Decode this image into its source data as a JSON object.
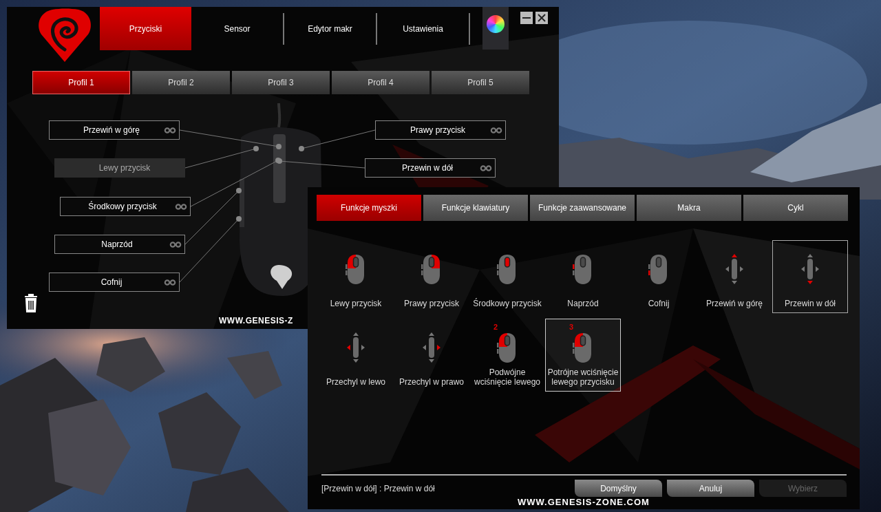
{
  "main_window": {
    "top_tabs": [
      {
        "label": "Przyciski",
        "selected": true
      },
      {
        "label": "Sensor",
        "selected": false
      },
      {
        "label": "Edytor makr",
        "selected": false
      },
      {
        "label": "Ustawienia",
        "selected": false
      }
    ],
    "profiles": [
      {
        "label": "Profil 1",
        "selected": true
      },
      {
        "label": "Profil 2",
        "selected": false
      },
      {
        "label": "Profil 3",
        "selected": false
      },
      {
        "label": "Profil 4",
        "selected": false
      },
      {
        "label": "Profil 5",
        "selected": false
      }
    ],
    "button_assignments": [
      {
        "label": "Przewiń w górę",
        "disabled": false
      },
      {
        "label": "Lewy przycisk",
        "disabled": true
      },
      {
        "label": "Środkowy przycisk",
        "disabled": false
      },
      {
        "label": "Naprzód",
        "disabled": false
      },
      {
        "label": "Cofnij",
        "disabled": false
      },
      {
        "label": "Prawy przycisk",
        "disabled": false
      },
      {
        "label": "Przewin w dół",
        "disabled": false
      }
    ],
    "website": "WWW.GENESIS-Z"
  },
  "dialog": {
    "tabs": [
      {
        "label": "Funkcje myszki",
        "selected": true
      },
      {
        "label": "Funkcje klawiatury",
        "selected": false
      },
      {
        "label": "Funkcje zaawansowane",
        "selected": false
      },
      {
        "label": "Makra",
        "selected": false
      },
      {
        "label": "Cykl",
        "selected": false
      }
    ],
    "functions": [
      {
        "label": "Lewy przycisk",
        "kind": "left",
        "selected": false,
        "hovered": false
      },
      {
        "label": "Prawy przycisk",
        "kind": "right",
        "selected": false,
        "hovered": false
      },
      {
        "label": "Środkowy przycisk",
        "kind": "middle",
        "selected": false,
        "hovered": false
      },
      {
        "label": "Naprzód",
        "kind": "forward",
        "selected": false,
        "hovered": false
      },
      {
        "label": "Cofnij",
        "kind": "back",
        "selected": false,
        "hovered": false
      },
      {
        "label": "Przewiń w górę",
        "kind": "up",
        "selected": false,
        "hovered": false
      },
      {
        "label": "Przewin w dół",
        "kind": "down",
        "selected": true,
        "hovered": false
      },
      {
        "label": "Przechyl w lewo",
        "kind": "tiltleft",
        "selected": false,
        "hovered": false
      },
      {
        "label": "Przechyl w prawo",
        "kind": "tiltright",
        "selected": false,
        "hovered": false
      },
      {
        "label": "Podwójne wciśnięcie lewego",
        "kind": "left",
        "badge": "2",
        "selected": false,
        "hovered": false
      },
      {
        "label": "Potrójne wciśnięcie lewego przycisku",
        "kind": "left",
        "badge": "3",
        "selected": false,
        "hovered": true
      }
    ],
    "status": "[Przewin w dół] : Przewin w dół",
    "buttons": [
      {
        "label": "Domyślny",
        "disabled": false
      },
      {
        "label": "Anuluj",
        "disabled": false
      },
      {
        "label": "Wybierz",
        "disabled": true
      }
    ],
    "website": "WWW.GENESIS-ZONE.COM"
  }
}
